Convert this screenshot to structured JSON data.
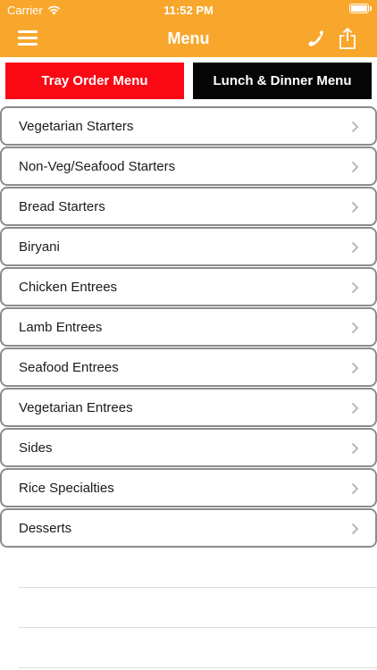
{
  "status_bar": {
    "carrier": "Carrier",
    "time": "11:52 PM"
  },
  "nav": {
    "title": "Menu",
    "left_icon": "hamburger-menu-icon",
    "right_icons": [
      "phone-icon",
      "share-icon"
    ]
  },
  "menu_tabs": {
    "tray_label": "Tray Order Menu",
    "lunch_label": "Lunch & Dinner Menu"
  },
  "categories": [
    "Vegetarian Starters",
    "Non-Veg/Seafood Starters",
    "Bread Starters",
    "Biryani",
    "Chicken Entrees",
    "Lamb Entrees",
    "Seafood Entrees",
    "Vegetarian Entrees",
    "Sides",
    "Rice Specialties",
    "Desserts"
  ],
  "colors": {
    "nav_background": "#f8a72c",
    "tray_button": "#fa0813",
    "lunch_button": "#050505"
  }
}
